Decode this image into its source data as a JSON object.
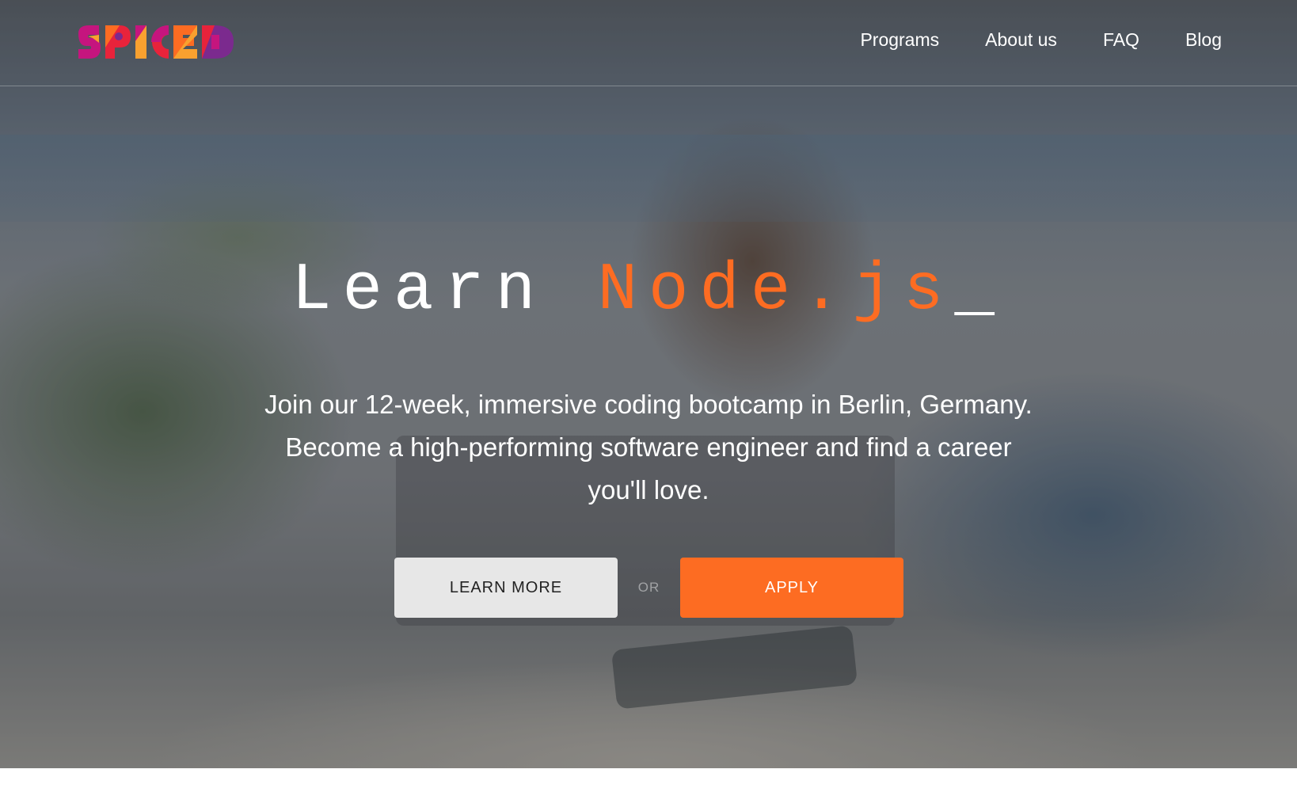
{
  "brand": {
    "logo_text": "SPICED",
    "colors": {
      "orange": "#fd6c22",
      "magenta": "#c5157e",
      "purple": "#7b2a8e",
      "red": "#e8233b",
      "yellow": "#f9a12f"
    }
  },
  "nav": {
    "items": [
      {
        "label": "Programs"
      },
      {
        "label": "About us"
      },
      {
        "label": "FAQ"
      },
      {
        "label": "Blog"
      }
    ]
  },
  "hero": {
    "headline_prefix": "Learn",
    "headline_accent": "Node.js",
    "headline_cursor": "_",
    "accent_color": "#fd6c22",
    "subtitle": "Join our 12-week, immersive coding bootcamp in Berlin, Germany. Become a high-performing software engineer and find a career you'll love.",
    "learn_more_label": "LEARN MORE",
    "or_label": "OR",
    "apply_label": "APPLY"
  }
}
